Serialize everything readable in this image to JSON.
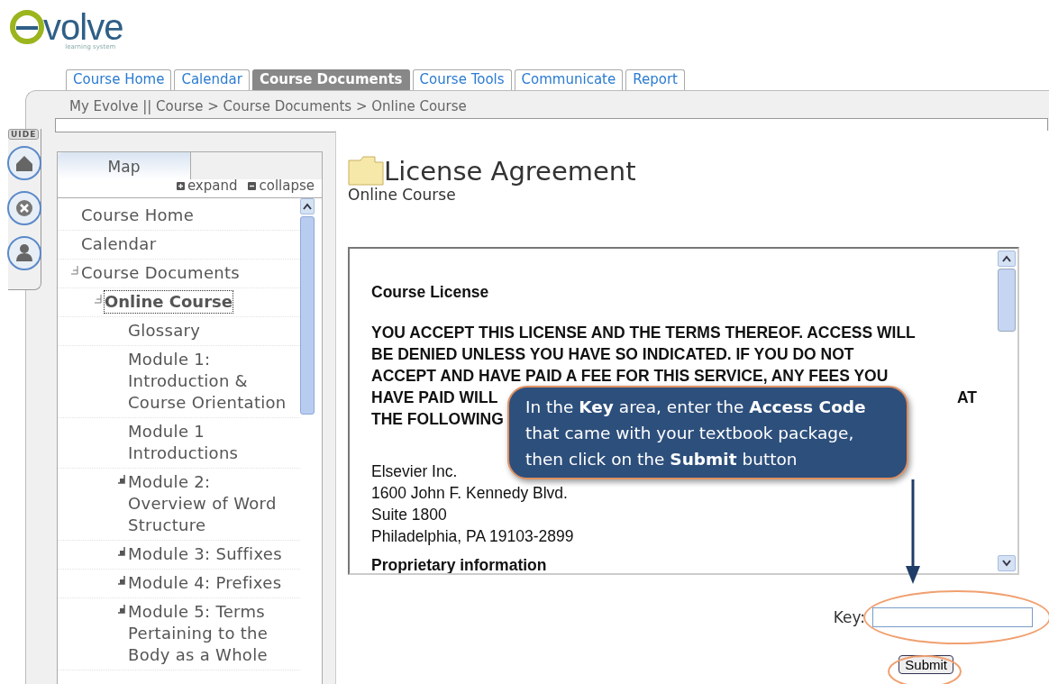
{
  "logo": {
    "word": "volve",
    "tagline": "learning system"
  },
  "tabs": [
    {
      "label": "Course Home",
      "selected": false
    },
    {
      "label": "Calendar",
      "selected": false
    },
    {
      "label": "Course Documents",
      "selected": true
    },
    {
      "label": "Course Tools",
      "selected": false
    },
    {
      "label": "Communicate",
      "selected": false
    },
    {
      "label": "Report",
      "selected": false
    }
  ],
  "breadcrumb": "My Evolve || Course > Course Documents > Online Course",
  "guide_tab": "UIDE",
  "map": {
    "tab": "Map",
    "expand": "expand",
    "collapse": "collapse",
    "tree": [
      {
        "label": "Course Home",
        "selected": false
      },
      {
        "label": "Calendar",
        "selected": false
      },
      {
        "label": "Course Documents",
        "selected": false,
        "expanded": true,
        "children": [
          {
            "label": "Online Course",
            "selected": true,
            "expanded": true,
            "children": [
              {
                "label": "Glossary",
                "selected": false
              },
              {
                "label": "Module 1: Introduction & Course Orientation",
                "selected": false
              },
              {
                "label": "Module 1 Introductions",
                "selected": false
              },
              {
                "label": "Module 2: Overview of Word Structure",
                "selected": false,
                "expanded": false
              },
              {
                "label": "Module 3: Suffixes",
                "selected": false,
                "expanded": false
              },
              {
                "label": "Module 4: Prefixes",
                "selected": false,
                "expanded": false
              },
              {
                "label": "Module 5: Terms Pertaining to the Body as a Whole",
                "selected": false,
                "expanded": false
              }
            ]
          }
        ]
      }
    ]
  },
  "page": {
    "title": "License Agreement",
    "subtitle": "Online Course"
  },
  "license": {
    "heading": "Course License",
    "lines": [
      [
        "YOU ACCEPT THIS LICENSE AND THE TERMS THEREOF. ACCESS WILL"
      ],
      [
        "BE DENIED UNLESS YOU HAVE SO INDICATED. IF YOU DO NOT"
      ],
      [
        "ACCEPT AND HAVE PAID A FEE FOR THIS SERVICE, ANY FEES YOU"
      ],
      [
        "HAVE PAID WILL",
        "AT"
      ],
      [
        "THE FOLLOWING"
      ]
    ],
    "address": [
      "Elsevier Inc.",
      "1600 John F. Kennedy Blvd.",
      "Suite 1800",
      "Philadelphia, PA 19103-2899"
    ],
    "next_heading": "Proprietary information"
  },
  "key_label": "Key:",
  "submit": "Submit",
  "callout": "In the **Key** area, enter the **Access Code** that came with your textbook package, then click on the **Submit** button"
}
